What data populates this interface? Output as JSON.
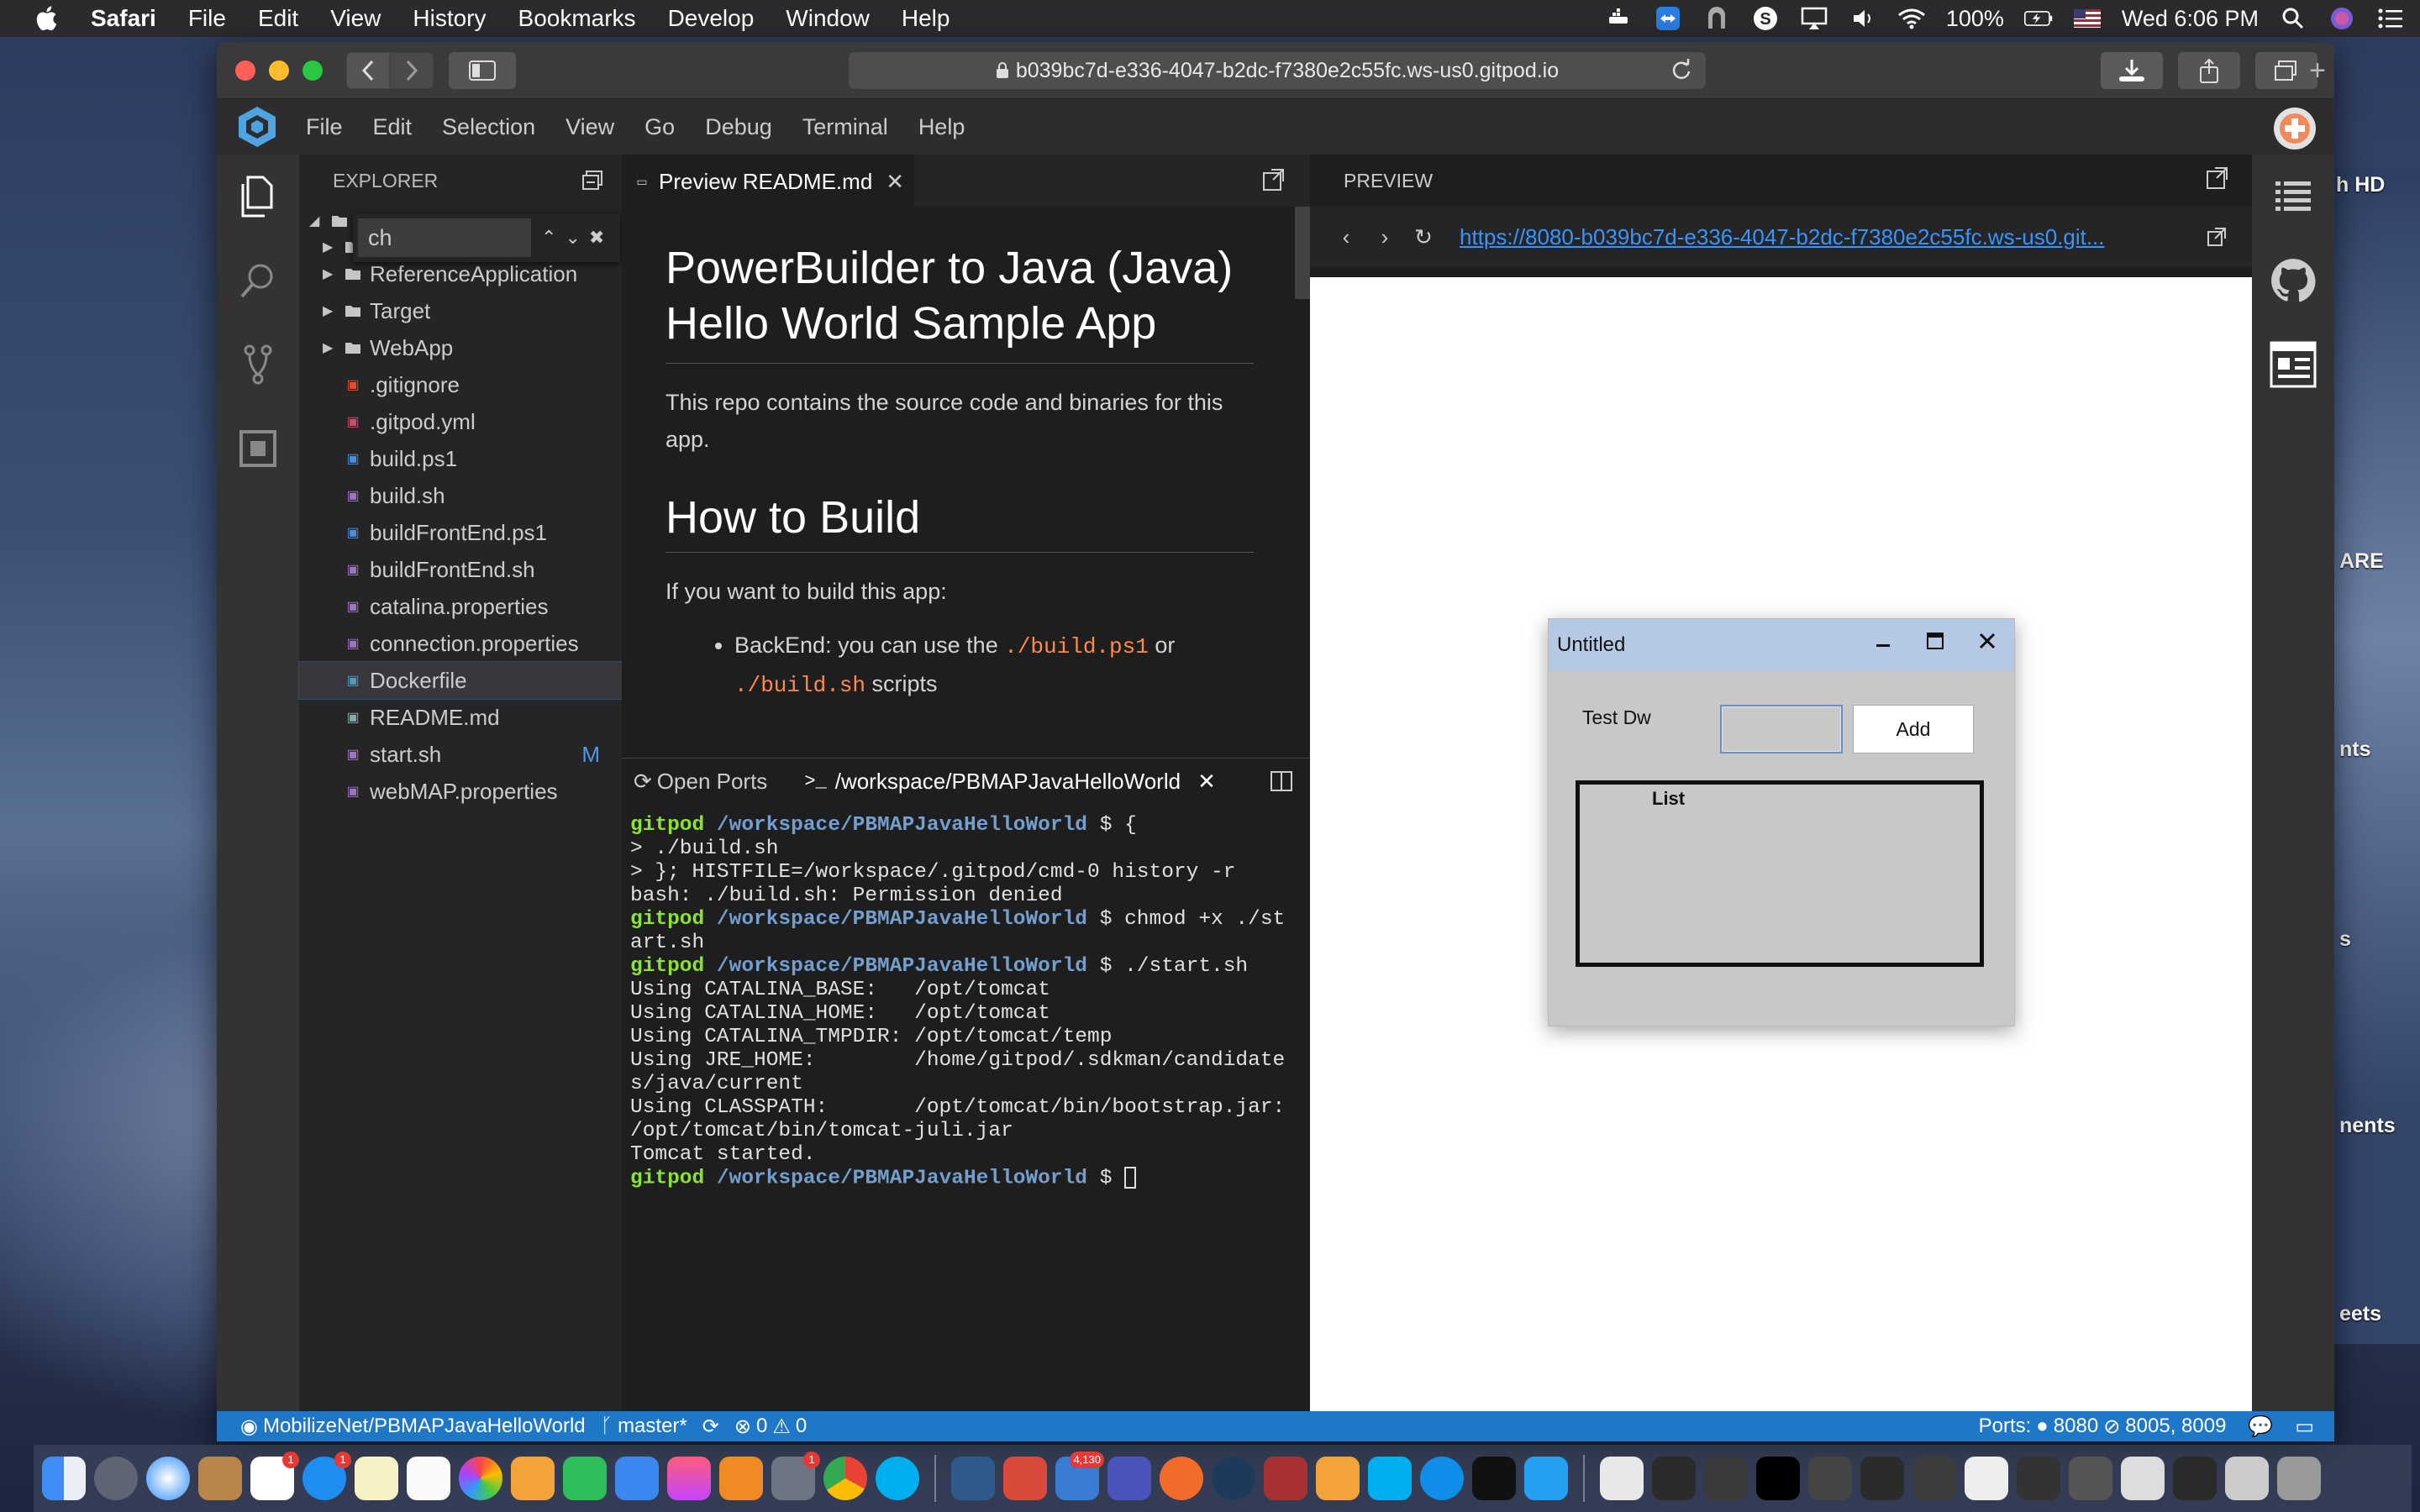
{
  "menubar": {
    "app_name": "Safari",
    "items": [
      "File",
      "Edit",
      "View",
      "History",
      "Bookmarks",
      "Develop",
      "Window",
      "Help"
    ],
    "battery": "100%",
    "clock": "Wed 6:06 PM"
  },
  "safari": {
    "url": "b039bc7d-e336-4047-b2dc-f7380e2c55fc.ws-us0.gitpod.io"
  },
  "ide": {
    "menu": [
      "File",
      "Edit",
      "Selection",
      "View",
      "Go",
      "Debug",
      "Terminal",
      "Help"
    ],
    "explorer": {
      "title": "EXPLORER",
      "find_value": "ch",
      "folders": [
        "null",
        "ReferenceApplication",
        "Target",
        "WebApp"
      ],
      "files": [
        {
          "name": ".gitignore",
          "icon_color": "#e44d26",
          "badge": ""
        },
        {
          "name": ".gitpod.yml",
          "icon_color": "#c9506b",
          "badge": ""
        },
        {
          "name": "build.ps1",
          "icon_color": "#4d8ad9",
          "badge": ""
        },
        {
          "name": "build.sh",
          "icon_color": "#a074c4",
          "badge": ""
        },
        {
          "name": "buildFrontEnd.ps1",
          "icon_color": "#4d8ad9",
          "badge": ""
        },
        {
          "name": "buildFrontEnd.sh",
          "icon_color": "#a074c4",
          "badge": ""
        },
        {
          "name": "catalina.properties",
          "icon_color": "#a074c4",
          "badge": ""
        },
        {
          "name": "connection.properties",
          "icon_color": "#a074c4",
          "badge": ""
        },
        {
          "name": "Dockerfile",
          "icon_color": "#519aba",
          "badge": ""
        },
        {
          "name": "README.md",
          "icon_color": "#8aa",
          "badge": ""
        },
        {
          "name": "start.sh",
          "icon_color": "#a074c4",
          "badge": "M"
        },
        {
          "name": "webMAP.properties",
          "icon_color": "#a074c4",
          "badge": ""
        }
      ],
      "selected": "Dockerfile"
    },
    "editor": {
      "tab_label": "Preview README.md",
      "h1": "PowerBuilder to Java (Java) Hello World Sample App",
      "p1": "This repo contains the source code and binaries for this app.",
      "h2": "How to Build",
      "p2": "If you want to build this app:",
      "bullet_prefix": "BackEnd: you can use the ",
      "bullet_code1": "./build.ps1",
      "bullet_mid": " or",
      "bullet_code2": "./build.sh",
      "bullet_suffix": " scripts"
    },
    "terminal": {
      "tab_ports": "Open Ports",
      "tab_terminal": "/workspace/PBMAPJavaHelloWorld",
      "prompt_user": "gitpod",
      "prompt_path": "/workspace/PBMAPJavaHelloWorld",
      "lines": [
        {
          "type": "prompt",
          "cmd": "$ {"
        },
        {
          "type": "out",
          "text": "> ./build.sh"
        },
        {
          "type": "out",
          "text": "> }; HISTFILE=/workspace/.gitpod/cmd-0 history -r"
        },
        {
          "type": "out",
          "text": "bash: ./build.sh: Permission denied"
        },
        {
          "type": "prompt",
          "cmd": "$ chmod +x ./st"
        },
        {
          "type": "out",
          "text": "art.sh"
        },
        {
          "type": "prompt",
          "cmd": "$ ./start.sh"
        },
        {
          "type": "out",
          "text": "Using CATALINA_BASE:   /opt/tomcat"
        },
        {
          "type": "out",
          "text": "Using CATALINA_HOME:   /opt/tomcat"
        },
        {
          "type": "out",
          "text": "Using CATALINA_TMPDIR: /opt/tomcat/temp"
        },
        {
          "type": "out",
          "text": "Using JRE_HOME:        /home/gitpod/.sdkman/candidate"
        },
        {
          "type": "out",
          "text": "s/java/current"
        },
        {
          "type": "out",
          "text": "Using CLASSPATH:       /opt/tomcat/bin/bootstrap.jar:"
        },
        {
          "type": "out",
          "text": "/opt/tomcat/bin/tomcat-juli.jar"
        },
        {
          "type": "out",
          "text": "Tomcat started."
        },
        {
          "type": "prompt_cursor",
          "cmd": "$ "
        }
      ]
    },
    "preview": {
      "title": "PREVIEW",
      "url": "https://8080-b039bc7d-e336-4047-b2dc-f7380e2c55fc.ws-us0.git...",
      "app": {
        "window_title": "Untitled",
        "label": "Test Dw",
        "button": "Add",
        "list_header": "List"
      }
    },
    "statusbar": {
      "repo": "MobilizeNet/PBMAPJavaHelloWorld",
      "branch": "master*",
      "errors": "0",
      "warnings": "0",
      "ports_label": "Ports:",
      "port_open": "8080",
      "ports_other": "8005, 8009"
    }
  },
  "desktop": {
    "edge_labels": [
      "h HD",
      "ARE",
      "nts",
      "s",
      "nents",
      "eets"
    ]
  }
}
